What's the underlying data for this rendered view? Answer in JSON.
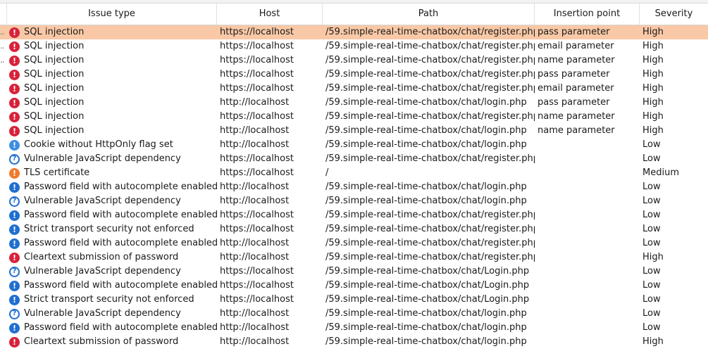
{
  "columns": {
    "issue_type": "Issue type",
    "host": "Host",
    "path": "Path",
    "insertion_point": "Insertion point",
    "severity": "Severity"
  },
  "icon_names": {
    "high": "high-severity-icon",
    "medium": "medium-severity-icon",
    "low": "low-severity-icon",
    "info": "information-icon",
    "tentative": "tentative-question-icon"
  },
  "rows": [
    {
      "issue": "SQL injection",
      "host": "https://localhost",
      "path": "/59.simple-real-time-chatbox/chat/register.php",
      "insertion": "pass parameter",
      "severity": "High",
      "icon": "high",
      "dots": "..",
      "selected": true
    },
    {
      "issue": "SQL injection",
      "host": "https://localhost",
      "path": "/59.simple-real-time-chatbox/chat/register.php",
      "insertion": "email parameter",
      "severity": "High",
      "icon": "high",
      "dots": ".."
    },
    {
      "issue": "SQL injection",
      "host": "https://localhost",
      "path": "/59.simple-real-time-chatbox/chat/register.php",
      "insertion": "name parameter",
      "severity": "High",
      "icon": "high",
      "dots": ".."
    },
    {
      "issue": "SQL injection",
      "host": "https://localhost",
      "path": "/59.simple-real-time-chatbox/chat/register.php",
      "insertion": "pass parameter",
      "severity": "High",
      "icon": "high"
    },
    {
      "issue": "SQL injection",
      "host": "https://localhost",
      "path": "/59.simple-real-time-chatbox/chat/register.php",
      "insertion": "email parameter",
      "severity": "High",
      "icon": "high"
    },
    {
      "issue": "SQL injection",
      "host": "http://localhost",
      "path": "/59.simple-real-time-chatbox/chat/login.php",
      "insertion": "pass parameter",
      "severity": "High",
      "icon": "high"
    },
    {
      "issue": "SQL injection",
      "host": "https://localhost",
      "path": "/59.simple-real-time-chatbox/chat/register.php",
      "insertion": "name parameter",
      "severity": "High",
      "icon": "high"
    },
    {
      "issue": "SQL injection",
      "host": "http://localhost",
      "path": "/59.simple-real-time-chatbox/chat/login.php",
      "insertion": "name parameter",
      "severity": "High",
      "icon": "high"
    },
    {
      "issue": "Cookie without HttpOnly flag set",
      "host": "http://localhost",
      "path": "/59.simple-real-time-chatbox/chat/login.php",
      "insertion": "",
      "severity": "Low",
      "icon": "info"
    },
    {
      "issue": "Vulnerable JavaScript dependency",
      "host": "https://localhost",
      "path": "/59.simple-real-time-chatbox/chat/register.php",
      "insertion": "",
      "severity": "Low",
      "icon": "tentative"
    },
    {
      "issue": "TLS certificate",
      "host": "https://localhost",
      "path": "/",
      "insertion": "",
      "severity": "Medium",
      "icon": "medium"
    },
    {
      "issue": "Password field with autocomplete enabled",
      "host": "http://localhost",
      "path": "/59.simple-real-time-chatbox/chat/login.php",
      "insertion": "",
      "severity": "Low",
      "icon": "low"
    },
    {
      "issue": "Vulnerable JavaScript dependency",
      "host": "http://localhost",
      "path": "/59.simple-real-time-chatbox/chat/login.php",
      "insertion": "",
      "severity": "Low",
      "icon": "tentative"
    },
    {
      "issue": "Password field with autocomplete enabled",
      "host": "https://localhost",
      "path": "/59.simple-real-time-chatbox/chat/register.php",
      "insertion": "",
      "severity": "Low",
      "icon": "low"
    },
    {
      "issue": "Strict transport security not enforced",
      "host": "https://localhost",
      "path": "/59.simple-real-time-chatbox/chat/register.php",
      "insertion": "",
      "severity": "Low",
      "icon": "low"
    },
    {
      "issue": "Password field with autocomplete enabled",
      "host": "http://localhost",
      "path": "/59.simple-real-time-chatbox/chat/register.php",
      "insertion": "",
      "severity": "Low",
      "icon": "low"
    },
    {
      "issue": "Cleartext submission of password",
      "host": "http://localhost",
      "path": "/59.simple-real-time-chatbox/chat/register.php",
      "insertion": "",
      "severity": "High",
      "icon": "high"
    },
    {
      "issue": "Vulnerable JavaScript dependency",
      "host": "https://localhost",
      "path": "/59.simple-real-time-chatbox/chat/Login.php",
      "insertion": "",
      "severity": "Low",
      "icon": "tentative"
    },
    {
      "issue": "Password field with autocomplete enabled",
      "host": "https://localhost",
      "path": "/59.simple-real-time-chatbox/chat/Login.php",
      "insertion": "",
      "severity": "Low",
      "icon": "low"
    },
    {
      "issue": "Strict transport security not enforced",
      "host": "https://localhost",
      "path": "/59.simple-real-time-chatbox/chat/Login.php",
      "insertion": "",
      "severity": "Low",
      "icon": "low"
    },
    {
      "issue": "Vulnerable JavaScript dependency",
      "host": "http://localhost",
      "path": "/59.simple-real-time-chatbox/chat/login.php",
      "insertion": "",
      "severity": "Low",
      "icon": "tentative"
    },
    {
      "issue": "Password field with autocomplete enabled",
      "host": "http://localhost",
      "path": "/59.simple-real-time-chatbox/chat/login.php",
      "insertion": "",
      "severity": "Low",
      "icon": "low"
    },
    {
      "issue": "Cleartext submission of password",
      "host": "http://localhost",
      "path": "/59.simple-real-time-chatbox/chat/login.php",
      "insertion": "",
      "severity": "High",
      "icon": "high"
    }
  ]
}
